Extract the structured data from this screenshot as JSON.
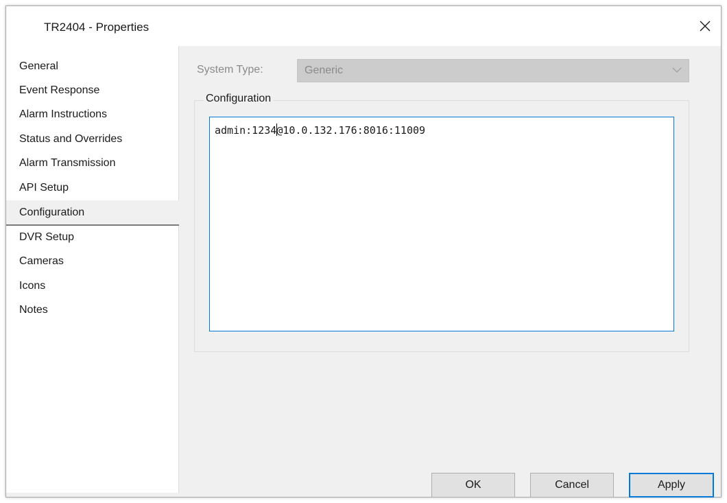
{
  "window": {
    "title": "TR2404 - Properties"
  },
  "sidebar": {
    "items": [
      {
        "label": "General"
      },
      {
        "label": "Event Response"
      },
      {
        "label": "Alarm Instructions"
      },
      {
        "label": "Status and Overrides"
      },
      {
        "label": "Alarm Transmission"
      },
      {
        "label": "API Setup"
      },
      {
        "label": "Configuration"
      },
      {
        "label": "DVR Setup"
      },
      {
        "label": "Cameras"
      },
      {
        "label": "Icons"
      },
      {
        "label": "Notes"
      }
    ],
    "selected": "Configuration"
  },
  "system_type": {
    "label": "System Type:",
    "value": "Generic"
  },
  "configuration": {
    "group_title": "Configuration",
    "text_before_cursor": "admin:1234",
    "text_after_cursor": "@10.0.132.176:8016:11009"
  },
  "buttons": {
    "ok": "OK",
    "cancel": "Cancel",
    "apply": "Apply"
  },
  "colors": {
    "accent": "#0078d7",
    "panel": "#f0f0f0",
    "disabled": "#cccccc"
  },
  "icons": {
    "close": "close-icon",
    "dropdown": "chevron-down-icon"
  }
}
